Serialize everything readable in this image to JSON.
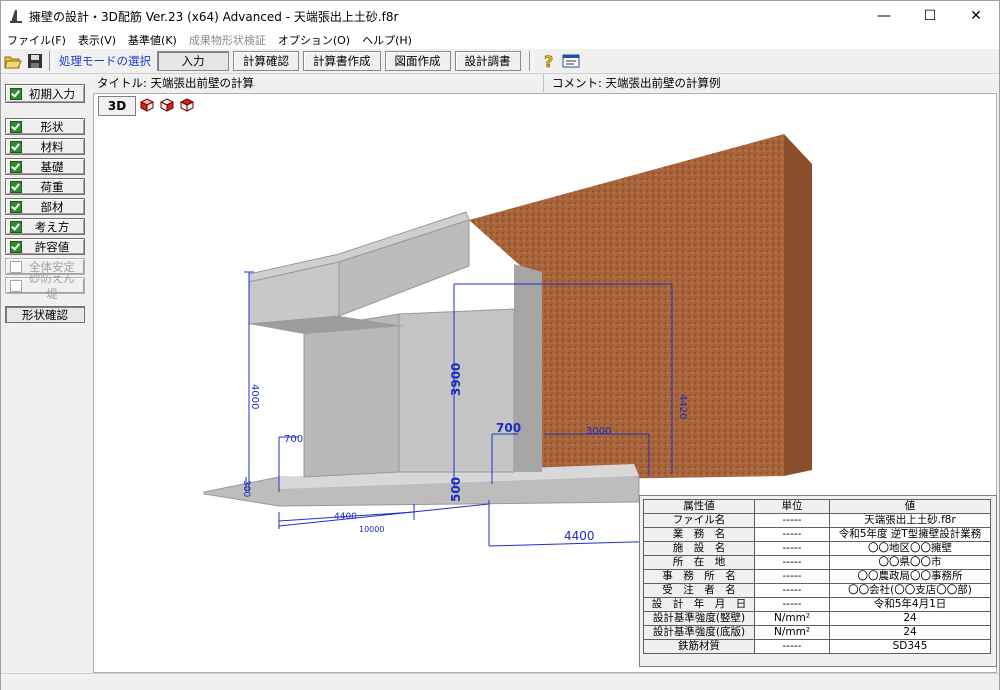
{
  "window": {
    "title": "擁壁の設計・3D配筋 Ver.23 (x64) Advanced - 天端張出上土砂.f8r",
    "minimize": "—",
    "maximize": "☐",
    "close": "✕"
  },
  "menu": [
    {
      "label": "ファイル(F)"
    },
    {
      "label": "表示(V)"
    },
    {
      "label": "基準値(K)"
    },
    {
      "label": "成果物形状検証"
    },
    {
      "label": "オプション(O)"
    },
    {
      "label": "ヘルプ(H)"
    }
  ],
  "toolbar": {
    "mode_label": "処理モードの選択",
    "input": "入力",
    "calc_check": "計算確認",
    "report": "計算書作成",
    "drawing": "図面作成",
    "design_survey": "設計調書"
  },
  "sidebar": {
    "initial_input": "初期入力",
    "items": [
      {
        "label": "形状"
      },
      {
        "label": "材料"
      },
      {
        "label": "基礎"
      },
      {
        "label": "荷重"
      },
      {
        "label": "部材"
      },
      {
        "label": "考え方"
      },
      {
        "label": "許容値"
      },
      {
        "label": "全体安定"
      },
      {
        "label": "砂防えん堤"
      }
    ],
    "shape_check": "形状確認"
  },
  "info": {
    "title": "タイトル: 天端張出前壁の計算",
    "comment": "コメント: 天端張出前壁の計算例"
  },
  "view": {
    "btn3d": "3D",
    "dims": {
      "d4400": "4400",
      "d3900": "3900",
      "d4000": "4000",
      "d700a": "700",
      "d700b": "700",
      "d500": "500",
      "d300": "300",
      "d4420": "4420",
      "d3000": "3000",
      "d10000": "10000",
      "d4400b": "4400"
    }
  },
  "props": {
    "headers": [
      "属性値",
      "単位",
      "値"
    ],
    "rows": [
      [
        "ファイル名",
        "-----",
        "天端張出上土砂.f8r"
      ],
      [
        "業　務　名",
        "-----",
        "令和5年度 逆T型擁壁設計業務"
      ],
      [
        "施　設　名",
        "-----",
        "〇〇地区〇〇擁壁"
      ],
      [
        "所　在　地",
        "-----",
        "〇〇県〇〇市"
      ],
      [
        "事　務　所　名",
        "-----",
        "〇〇農政局〇〇事務所"
      ],
      [
        "受　注　者　名",
        "-----",
        "〇〇会社(〇〇支店〇〇部)"
      ],
      [
        "設　計　年　月　日",
        "-----",
        "令和5年4月1日"
      ],
      [
        "設計基準強度(竪壁)",
        "N/mm²",
        "24"
      ],
      [
        "設計基準強度(底版)",
        "N/mm²",
        "24"
      ],
      [
        "鉄筋材質",
        "-----",
        "SD345"
      ]
    ]
  }
}
